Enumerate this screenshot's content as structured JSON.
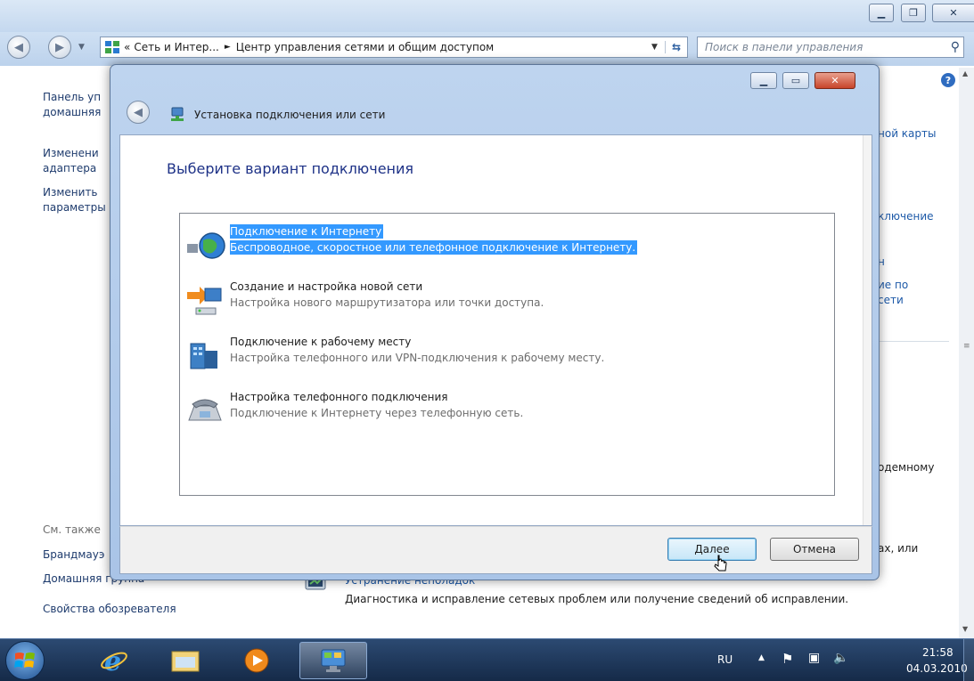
{
  "explorer": {
    "breadcrumb": {
      "prefix": "«",
      "parent": "Сеть и Интер...",
      "separator": "►",
      "current": "Центр управления сетями и общим доступом"
    },
    "search_placeholder": "Поиск в панели управления",
    "left_pane": {
      "items": [
        "Панель уп",
        "домашняя",
        "Изменени",
        "адаптера",
        "Изменить",
        "параметры"
      ],
      "see_also_title": "См. также",
      "see_also": [
        "Брандмауэ",
        "Домашняя группа",
        "Свойства обозревателя"
      ]
    },
    "right_pane": {
      "fragments": [
        "ной карты",
        "ключение",
        "н",
        "ие по",
        "сети",
        "одемному",
        "ах, или"
      ],
      "troubleshoot": {
        "title": "Устранение неполадок",
        "description": "Диагностика и исправление сетевых проблем или получение сведений об исправлении."
      }
    }
  },
  "dialog": {
    "title": "Установка подключения или сети",
    "heading": "Выберите вариант подключения",
    "options": [
      {
        "title": "Подключение к Интернету",
        "subtitle": "Беспроводное, скоростное или телефонное подключение к Интернету.",
        "icon": "globe-network-icon",
        "selected": true
      },
      {
        "title": "Создание и настройка новой сети",
        "subtitle": "Настройка нового маршрутизатора или точки доступа.",
        "icon": "router-setup-icon",
        "selected": false
      },
      {
        "title": "Подключение к рабочему месту",
        "subtitle": "Настройка телефонного или VPN-подключения к рабочему месту.",
        "icon": "workplace-icon",
        "selected": false
      },
      {
        "title": "Настройка телефонного подключения",
        "subtitle": "Подключение к Интернету через телефонную сеть.",
        "icon": "phone-modem-icon",
        "selected": false
      }
    ],
    "buttons": {
      "next": "Далее",
      "cancel": "Отмена"
    }
  },
  "taskbar": {
    "language": "RU",
    "time": "21:58",
    "date": "04.03.2010"
  },
  "colors": {
    "selection": "#3399ff",
    "link": "#1e5aa8",
    "taskbar": "#1c3558"
  }
}
